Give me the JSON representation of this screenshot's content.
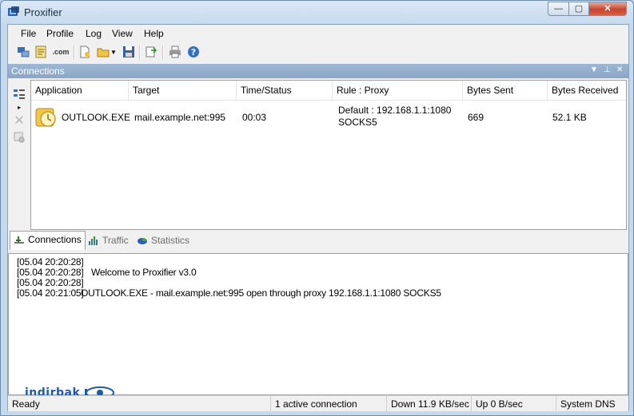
{
  "window": {
    "title": "Proxifier",
    "app_icon": "proxifier-icon"
  },
  "window_controls": {
    "minimize": "—",
    "maximize": "▢",
    "close": "✕"
  },
  "menu": [
    "File",
    "Profile",
    "Log",
    "View",
    "Help"
  ],
  "toolbar_icons": [
    "proxy-servers-icon",
    "rules-icon",
    "name-resolution-icon",
    "new-profile-icon",
    "open-profile-icon",
    "dropdown-arrow-icon",
    "save-profile-icon",
    "export-icon",
    "print-icon",
    "help-icon"
  ],
  "toolbar_dns_label": ".com",
  "pane": {
    "title": "Connections"
  },
  "grid": {
    "columns": [
      "Application",
      "Target",
      "Time/Status",
      "Rule : Proxy",
      "Bytes Sent",
      "Bytes Received"
    ],
    "rows": [
      {
        "application": "OUTLOOK.EXE",
        "target": "mail.example.net:995",
        "time_status": "00:03",
        "rule": "Default : 192.168.1.1:1080",
        "proxy": "SOCKS5",
        "bytes_sent": "669",
        "bytes_received": "52.1 KB"
      }
    ]
  },
  "tabs": [
    "Connections",
    "Traffic",
    "Statistics"
  ],
  "log": [
    {
      "time": "[05.04 20:20:28]",
      "msg": ""
    },
    {
      "time": "[05.04 20:20:28]",
      "msg": "Welcome to Proxifier v3.0"
    },
    {
      "time": "[05.04 20:20:28]",
      "msg": ""
    },
    {
      "time": "[05.04 20:21:05]",
      "msg": "OUTLOOK.EXE - mail.example.net:995 open through proxy 192.168.1.1:1080 SOCKS5"
    }
  ],
  "status": {
    "ready": "Ready",
    "connections": "1 active connection",
    "down": "Down 11.9 KB/sec",
    "up": "Up 0 B/sec",
    "dns": "System DNS"
  },
  "watermark": "indirbak",
  "colors": {
    "accent": "#1d5aa8",
    "pane_header": "#8aa6c8",
    "close": "#c8442c"
  }
}
